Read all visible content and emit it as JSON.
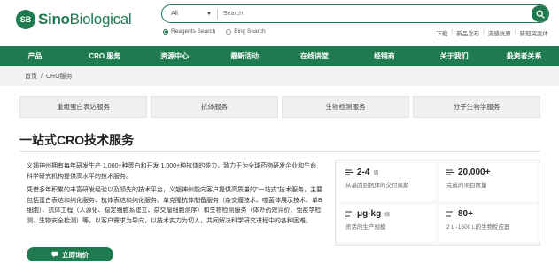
{
  "brand": {
    "mark": "SB",
    "name_bold": "Sino",
    "name_rest": "Biological"
  },
  "search": {
    "scope": "All",
    "placeholder": "Search"
  },
  "search_options": [
    {
      "label": "Reagents Search",
      "selected": true
    },
    {
      "label": "Bing Search",
      "selected": false
    }
  ],
  "top_links": [
    "下载",
    "新品发布",
    "流感抗原",
    "新冠突变体"
  ],
  "nav": [
    "产品",
    "CRO 服务",
    "资源中心",
    "最新活动",
    "在线讲堂",
    "经销商",
    "关于我们",
    "投资者关系"
  ],
  "breadcrumb": {
    "home": "首页",
    "separator": "/",
    "current": "CRO服务"
  },
  "tabs": [
    "重组蛋白表达服务",
    "抗体服务",
    "生物检测服务",
    "分子生物学服务"
  ],
  "page_title": "一站式CRO技术服务",
  "intro": {
    "p1": "义翘神州拥有每年研发生产 1,000+种蛋白和开发 1,000+种抗体的能力，致力于为全球药物研发企业和生命科学研究机构提供高水平的技术服务。",
    "p2": "凭借多年积累的丰富研发经验以及领先的技术平台，义翘神州能向客户提供高质量的\"一站式\"技术服务，主要包括蛋白表达和纯化服务、抗体表达和纯化服务、单克隆抗体制备服务（杂交瘤技术、噬菌体展示技术、单B细胞）、抗体工程（人源化、稳定细胞系建立、杂交瘤细胞测序）和生物检测服务（体外药效评价、免疫学检测、生物安全检测）等，以客户需求为导向，以技术实力为切入，共同解决科学研究进程中的各种困难。"
  },
  "cta_label": "立即询价",
  "stats": [
    {
      "value": "2-4",
      "unit": "周",
      "desc": "从基因到抗体的交付周期"
    },
    {
      "value": "20,000+",
      "unit": "",
      "desc": "完成的项目数量"
    },
    {
      "value": "μg-kg",
      "unit": "级",
      "desc": "灵活的生产规模"
    },
    {
      "value": "80+",
      "unit": "",
      "desc": "2 L -1500 L的生物反应器"
    }
  ]
}
